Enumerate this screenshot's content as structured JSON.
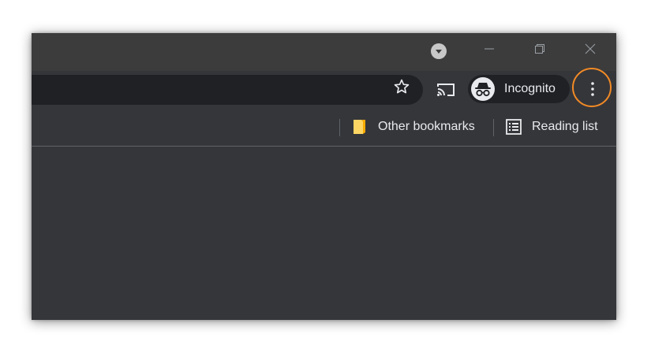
{
  "titlebar": {
    "tab_search_icon": "tab-search-icon",
    "minimize_icon": "minimize-icon",
    "restore_icon": "restore-icon",
    "close_icon": "close-icon"
  },
  "toolbar": {
    "bookmark_star_icon": "star-icon",
    "cast_icon": "cast-icon",
    "profile": {
      "label": "Incognito",
      "icon": "incognito-icon"
    },
    "menu_icon": "more-vertical-icon",
    "highlight_color": "#f28a25"
  },
  "bookmarks_bar": {
    "items": [
      {
        "label": "Other bookmarks",
        "icon": "folder-icon"
      },
      {
        "label": "Reading list",
        "icon": "reading-list-icon"
      }
    ]
  },
  "colors": {
    "window_bg": "#35363a",
    "titlebar_bg": "#3c3c3c",
    "omnibox_bg": "#202124",
    "text": "#e8eaed",
    "folder": "#fdd663"
  }
}
